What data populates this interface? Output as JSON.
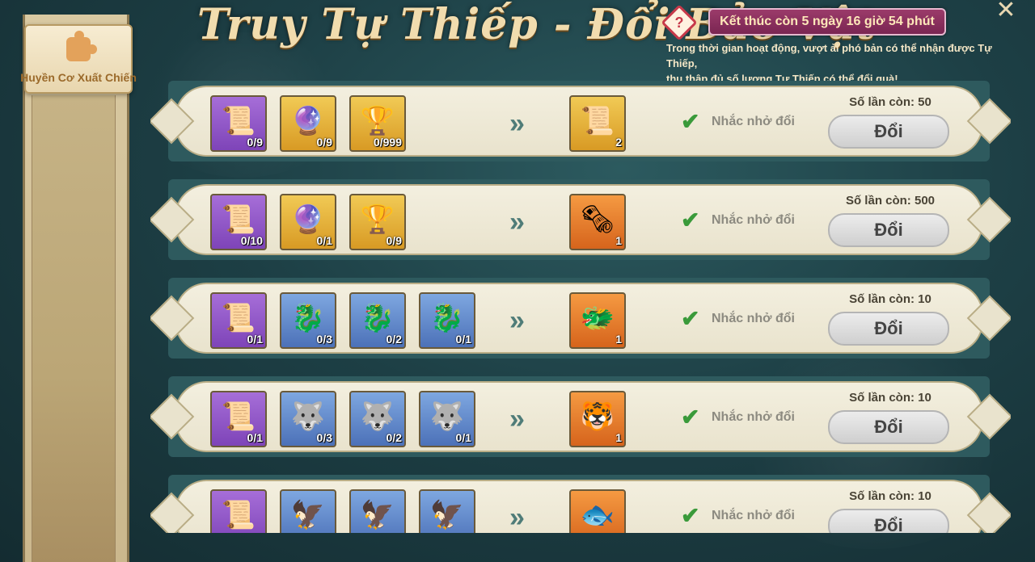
{
  "sidebar": {
    "tab_label": "Huyền Cơ Xuất Chiến"
  },
  "header": {
    "title": "Truy Tự Thiếp - Đổi Bảo Vật",
    "timer": "Kết thúc còn 5 ngày 16 giờ 54 phút",
    "help_symbol": "?",
    "description_line1": "Trong thời gian hoạt động, vượt ải phó bản có thể nhận được Tự Thiếp,",
    "description_line2": "thu thập đủ số lượng Tự Thiếp có thể đổi quà!",
    "close_symbol": "✕"
  },
  "common": {
    "arrow": "»",
    "check": "✔",
    "remind_label": "Nhắc nhở đổi",
    "exchange_label": "Đổi"
  },
  "rows": [
    {
      "inputs": [
        {
          "color": "purple",
          "glyph": "📜",
          "icon": "scroll-icon",
          "count": "0/9"
        },
        {
          "color": "gold",
          "glyph": "🔮",
          "icon": "dragon-orb-icon",
          "count": "0/9"
        },
        {
          "color": "gold",
          "glyph": "🏆",
          "icon": "chalice-icon",
          "count": "0/999"
        }
      ],
      "output": {
        "color": "gold",
        "glyph": "📜",
        "icon": "golden-scroll-icon",
        "count": "2"
      },
      "remaining": "Số lần còn: 50"
    },
    {
      "inputs": [
        {
          "color": "purple",
          "glyph": "📜",
          "icon": "scroll-icon",
          "count": "0/10"
        },
        {
          "color": "gold",
          "glyph": "🔮",
          "icon": "dragon-orb-icon",
          "count": "0/1"
        },
        {
          "color": "gold",
          "glyph": "🏆",
          "icon": "chalice-icon",
          "count": "0/9"
        }
      ],
      "output": {
        "color": "orange",
        "glyph": "🗞",
        "icon": "map-scroll-icon",
        "count": "1"
      },
      "remaining": "Số lần còn: 500"
    },
    {
      "inputs": [
        {
          "color": "purple",
          "glyph": "📜",
          "icon": "scroll-icon",
          "count": "0/1"
        },
        {
          "color": "blue",
          "glyph": "🐉",
          "icon": "golden-dragon-icon",
          "count": "0/3"
        },
        {
          "color": "blue",
          "glyph": "🐉",
          "icon": "golden-dragon-icon",
          "count": "0/2"
        },
        {
          "color": "blue",
          "glyph": "🐉",
          "icon": "golden-dragon-icon",
          "count": "0/1"
        }
      ],
      "output": {
        "color": "orange",
        "glyph": "🐲",
        "icon": "dark-dragon-icon",
        "count": "1"
      },
      "remaining": "Số lần còn: 10"
    },
    {
      "inputs": [
        {
          "color": "purple",
          "glyph": "📜",
          "icon": "scroll-icon",
          "count": "0/1"
        },
        {
          "color": "blue",
          "glyph": "🐺",
          "icon": "dark-beast-icon",
          "count": "0/3"
        },
        {
          "color": "blue",
          "glyph": "🐺",
          "icon": "dark-beast-icon",
          "count": "0/2"
        },
        {
          "color": "blue",
          "glyph": "🐺",
          "icon": "dark-beast-icon",
          "count": "0/1"
        }
      ],
      "output": {
        "color": "orange",
        "glyph": "🐯",
        "icon": "white-tiger-icon",
        "count": "1"
      },
      "remaining": "Số lần còn: 10"
    },
    {
      "inputs": [
        {
          "color": "purple",
          "glyph": "📜",
          "icon": "scroll-icon",
          "count": ""
        },
        {
          "color": "blue",
          "glyph": "🦅",
          "icon": "phoenix-beast-icon",
          "count": ""
        },
        {
          "color": "blue",
          "glyph": "🦅",
          "icon": "phoenix-beast-icon",
          "count": ""
        },
        {
          "color": "blue",
          "glyph": "🦅",
          "icon": "phoenix-beast-icon",
          "count": ""
        }
      ],
      "output": {
        "color": "orange",
        "glyph": "🐟",
        "icon": "azure-beast-icon",
        "count": ""
      },
      "remaining": "Số lần còn: 10"
    }
  ]
}
